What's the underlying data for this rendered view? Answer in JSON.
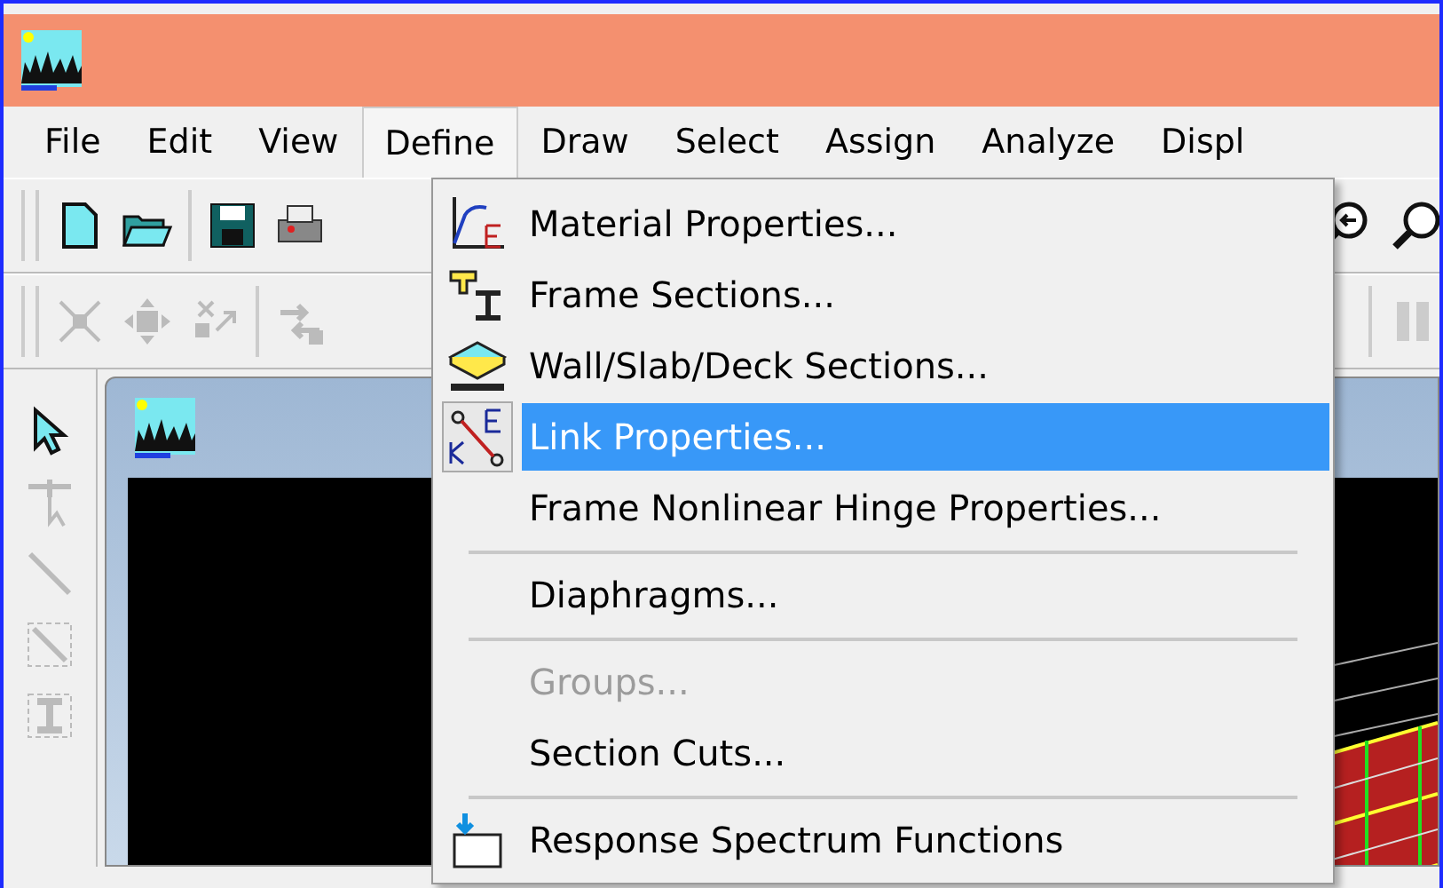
{
  "menu_bar": [
    {
      "label": "File",
      "selected": false
    },
    {
      "label": "Edit",
      "selected": false
    },
    {
      "label": "View",
      "selected": false
    },
    {
      "label": "Define",
      "selected": true
    },
    {
      "label": "Draw",
      "selected": false
    },
    {
      "label": "Select",
      "selected": false
    },
    {
      "label": "Assign",
      "selected": false
    },
    {
      "label": "Analyze",
      "selected": false
    },
    {
      "label": "Displ",
      "selected": false
    }
  ],
  "define_menu": [
    {
      "kind": "item",
      "label": "Material Properties...",
      "selected": false,
      "disabled": false
    },
    {
      "kind": "item",
      "label": "Frame Sections...",
      "selected": false,
      "disabled": false
    },
    {
      "kind": "item",
      "label": "Wall/Slab/Deck Sections...",
      "selected": false,
      "disabled": false
    },
    {
      "kind": "item",
      "label": "Link Properties...",
      "selected": true,
      "disabled": false
    },
    {
      "kind": "item",
      "label": "Frame Nonlinear Hinge Properties...",
      "selected": false,
      "disabled": false
    },
    {
      "kind": "separator"
    },
    {
      "kind": "item",
      "label": "Diaphragms...",
      "selected": false,
      "disabled": false
    },
    {
      "kind": "separator"
    },
    {
      "kind": "item",
      "label": "Groups...",
      "selected": false,
      "disabled": true
    },
    {
      "kind": "item",
      "label": "Section Cuts...",
      "selected": false,
      "disabled": false
    },
    {
      "kind": "separator"
    },
    {
      "kind": "item",
      "label": "Response Spectrum Functions",
      "selected": false,
      "disabled": false
    }
  ]
}
